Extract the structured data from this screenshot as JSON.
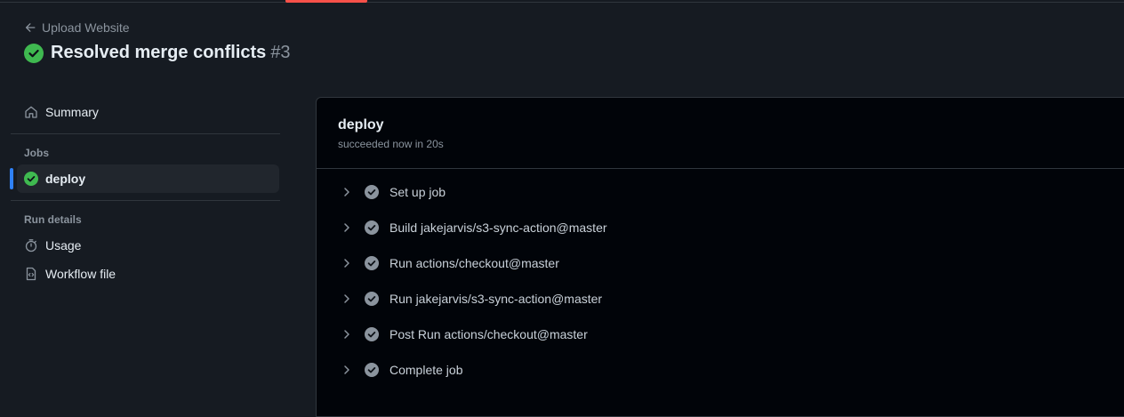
{
  "back_link": {
    "label": "Upload Website",
    "icon": "arrow-left-icon"
  },
  "run": {
    "title": "Resolved merge conflicts",
    "number": "#3",
    "status_color": "#3fb950"
  },
  "sidebar": {
    "summary_label": "Summary",
    "jobs_heading": "Jobs",
    "jobs": [
      {
        "label": "deploy",
        "status": "success"
      }
    ],
    "run_details_heading": "Run details",
    "usage_label": "Usage",
    "workflow_file_label": "Workflow file"
  },
  "job": {
    "name": "deploy",
    "status_text": "succeeded now in 20s",
    "steps": [
      {
        "label": "Set up job"
      },
      {
        "label": "Build jakejarvis/s3-sync-action@master"
      },
      {
        "label": "Run actions/checkout@master"
      },
      {
        "label": "Run jakejarvis/s3-sync-action@master"
      },
      {
        "label": "Post Run actions/checkout@master"
      },
      {
        "label": "Complete job"
      }
    ]
  },
  "colors": {
    "accent": "#2f81f7",
    "success": "#3fb950",
    "progress": "#f85149"
  }
}
